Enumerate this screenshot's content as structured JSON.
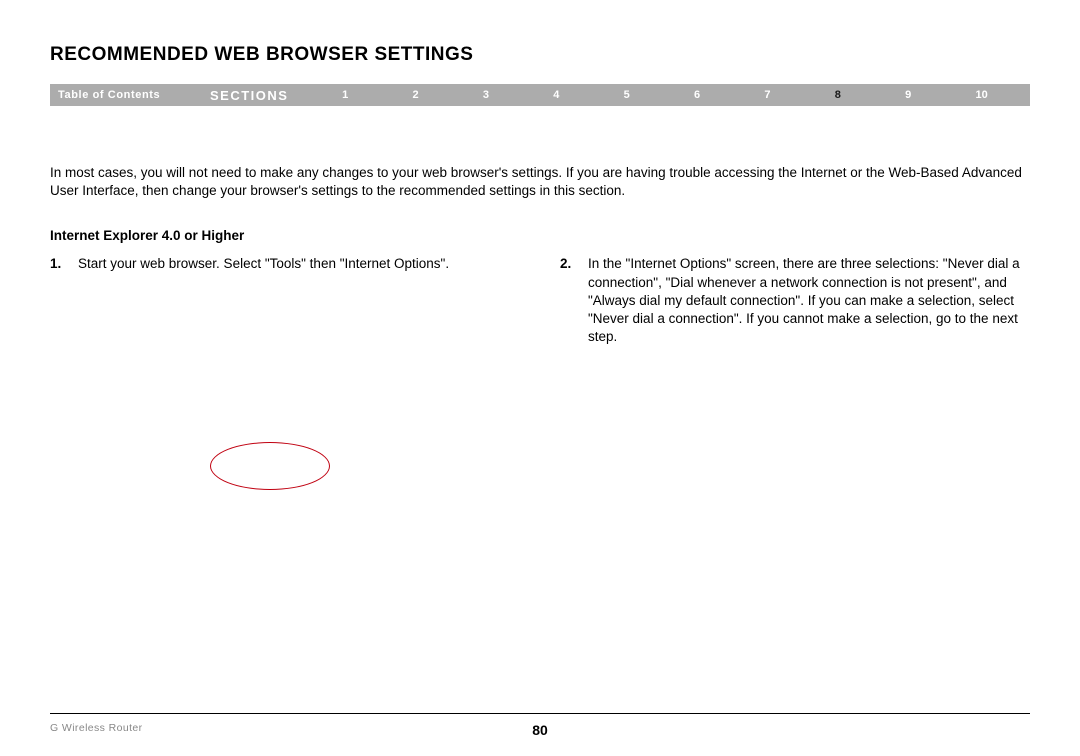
{
  "title": "RECOMMENDED WEB BROWSER SETTINGS",
  "navbar": {
    "toc": "Table of Contents",
    "sections_label": "SECTIONS",
    "items": [
      "1",
      "2",
      "3",
      "4",
      "5",
      "6",
      "7",
      "8",
      "9",
      "10"
    ],
    "active": "8"
  },
  "intro": "In most cases, you will not need to make any changes to your web browser's settings. If you are having trouble accessing the Internet or the Web-Based Advanced User Interface, then change your browser's settings to the recommended settings in this section.",
  "subheading": "Internet Explorer 4.0 or Higher",
  "steps": {
    "left": {
      "num": "1.",
      "text": "Start your web browser. Select \"Tools\" then \"Internet Options\"."
    },
    "right": {
      "num": "2.",
      "text": "In the \"Internet Options\" screen, there are three selections: \"Never dial a connection\", \"Dial whenever a network connection is not present\", and \"Always dial my default connection\". If you can make a selection, select \"Never dial a connection\". If you cannot make a selection, go to the next step."
    }
  },
  "footer": {
    "left": "G Wireless Router",
    "page": "80"
  }
}
